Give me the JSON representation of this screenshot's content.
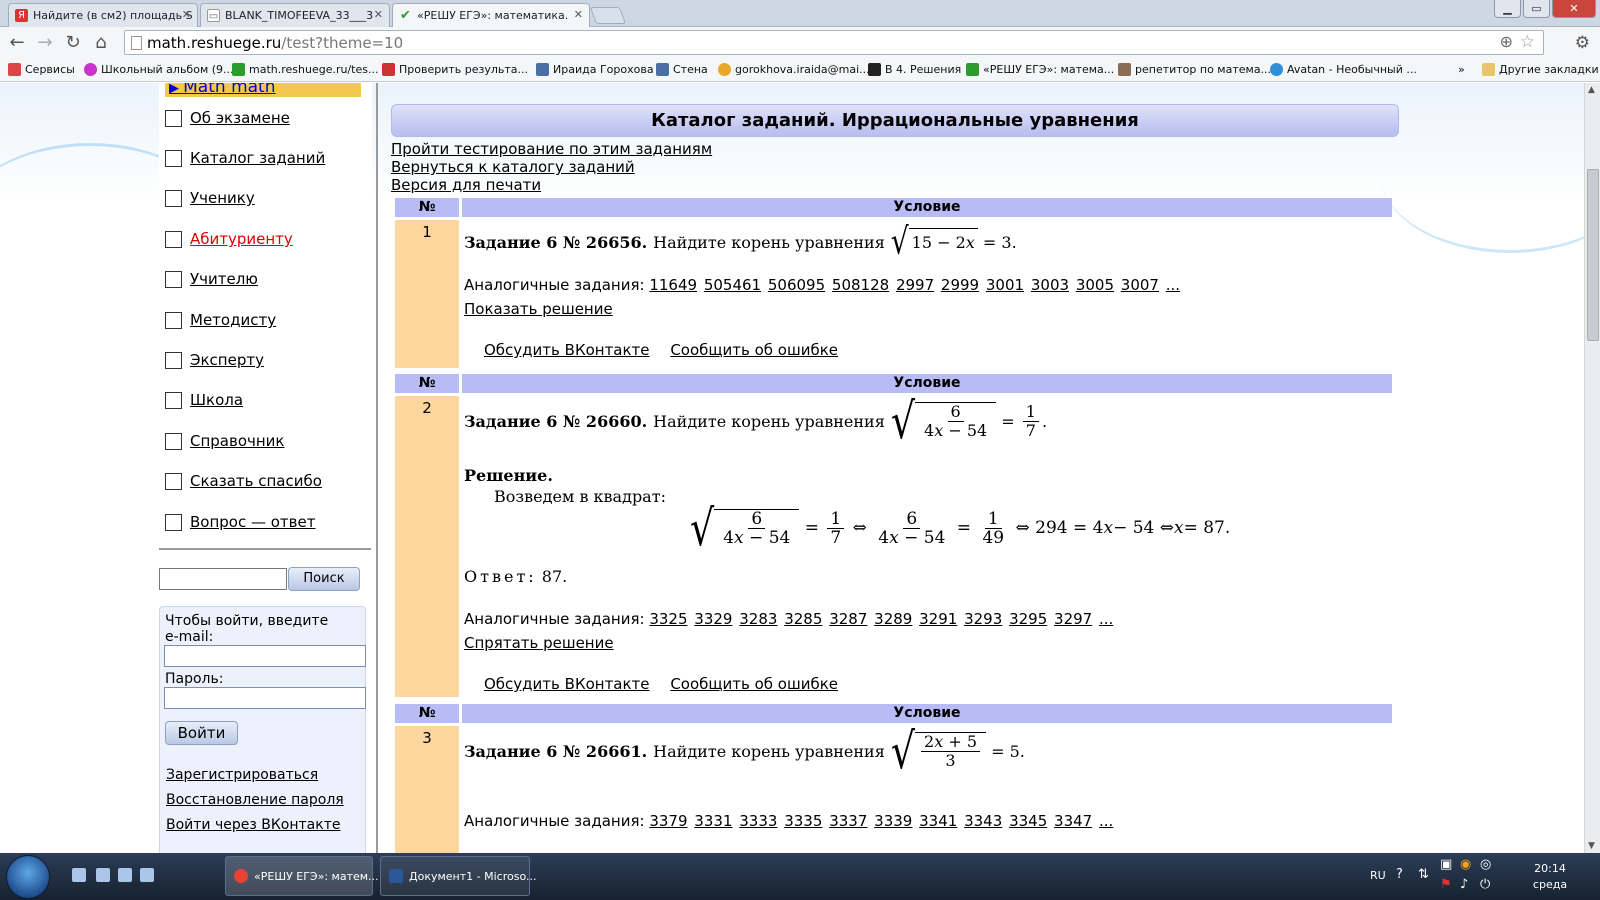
{
  "tabs": [
    {
      "title": "Найдите (в см2) площадь S",
      "icon": "Я",
      "color": "#d33"
    },
    {
      "title": "BLANK_TIMOFEEVA_33___3",
      "icon": "▭",
      "color": "#fff"
    },
    {
      "title": "«РЕШУ ЕГЭ»: математика.",
      "icon": "✔",
      "color": "#2a9d2a"
    }
  ],
  "window_buttons": {
    "minimize": "▁",
    "maximize": "▭",
    "close": "✕"
  },
  "address": {
    "host": "math.reshuege.ru",
    "path": "/test?theme=10"
  },
  "bookmarks": [
    {
      "label": "Сервисы",
      "color": "#d44"
    },
    {
      "label": "Школьный альбом (9...",
      "color": "#c3c"
    },
    {
      "label": "math.reshuege.ru/tes...",
      "color": "#2a9d2a"
    },
    {
      "label": "Проверить результа...",
      "color": "#c33"
    },
    {
      "label": "Ираида Горохова",
      "color": "#4a6fa5"
    },
    {
      "label": "Стена",
      "color": "#4a6fa5"
    },
    {
      "label": "gorokhova.iraida@mai...",
      "color": "#e8a82b"
    },
    {
      "label": "В 4. Решения",
      "color": "#222"
    },
    {
      "label": "«РЕШУ ЕГЭ»: матема...",
      "color": "#2a9d2a"
    },
    {
      "label": "репетитор по матема...",
      "color": "#8a6d55"
    },
    {
      "label": "Avatan - Необычный ...",
      "color": "#2f8fd8"
    }
  ],
  "bookmarks_more": "»",
  "other_bookmarks": "Другие закладки",
  "sidebar": {
    "top_link": "Math math",
    "menu": [
      {
        "label": "Об экзамене",
        "red": false
      },
      {
        "label": "Каталог заданий",
        "red": false
      },
      {
        "label": "Ученику",
        "red": false
      },
      {
        "label": "Абитуриенту",
        "red": true
      },
      {
        "label": "Учителю",
        "red": false
      },
      {
        "label": "Методисту",
        "red": false
      },
      {
        "label": "Эксперту",
        "red": false
      },
      {
        "label": "Школа",
        "red": false
      },
      {
        "label": "Справочник",
        "red": false
      },
      {
        "label": "Сказать спасибо",
        "red": false
      },
      {
        "label": "Вопрос — ответ",
        "red": false
      }
    ],
    "search_button": "Поиск",
    "login": {
      "email_label": "Чтобы войти, введите e-mail:",
      "password_label": "Пароль:",
      "login_button": "Войти",
      "register": "Зарегистрироваться",
      "restore": "Восстановление пароля",
      "vk_login": "Войти через ВКонтакте"
    }
  },
  "main": {
    "title": "Каталог заданий. Иррациональные уравнения",
    "links": [
      "Пройти тестирование по этим заданиям",
      "Вернуться к каталогу заданий",
      "Версия для печати"
    ],
    "col_num": "№",
    "col_cond": "Условие",
    "similar_label": "Аналогичные задания:",
    "discuss": "Обсудить ВКонтакте",
    "report": "Сообщить об ошибке",
    "tasks": [
      {
        "num": "1",
        "head": "Задание 6 № 26656.",
        "text": "Найдите корень уравнения",
        "similar": [
          "11649",
          "505461",
          "506095",
          "508128",
          "2997",
          "2999",
          "3001",
          "3003",
          "3005",
          "3007",
          "..."
        ],
        "toggle": "Показать решение"
      },
      {
        "num": "2",
        "head": "Задание 6 № 26660.",
        "text": "Найдите корень уравнения",
        "solution_head": "Решение.",
        "solution_text": "Возведем в квадрат:",
        "answer_label": "Ответ:",
        "answer_value": "87.",
        "similar": [
          "3325",
          "3329",
          "3283",
          "3285",
          "3287",
          "3289",
          "3291",
          "3293",
          "3295",
          "3297",
          "..."
        ],
        "toggle": "Спрятать решение"
      },
      {
        "num": "3",
        "head": "Задание 6 № 26661.",
        "text": "Найдите корень уравнения",
        "similar": [
          "3379",
          "3331",
          "3333",
          "3335",
          "3337",
          "3339",
          "3341",
          "3343",
          "3345",
          "3347",
          "..."
        ]
      }
    ]
  },
  "taskbar": {
    "tasks": [
      {
        "label": "«РЕШУ ЕГЭ»: матем...",
        "color": "#e94235"
      },
      {
        "label": "Документ1 - Microso...",
        "color": "#2b579a"
      }
    ],
    "lang": "RU",
    "time": "20:14",
    "day": "среда"
  }
}
